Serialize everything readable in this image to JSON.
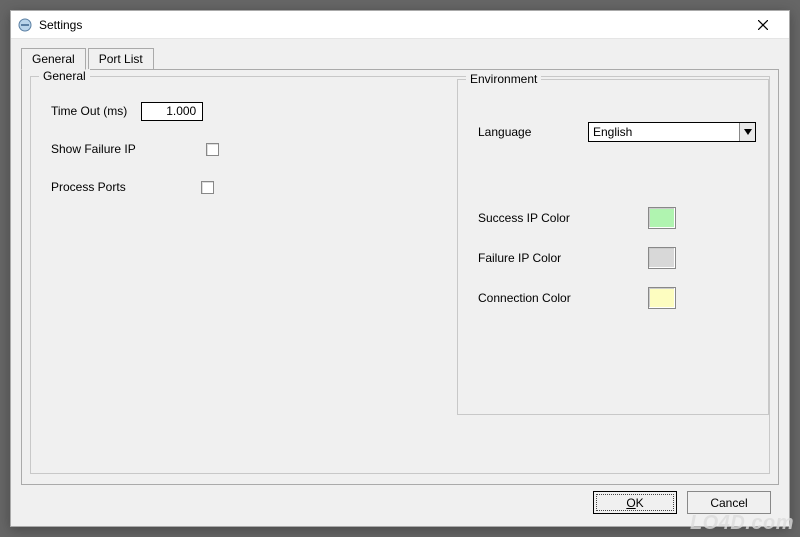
{
  "window": {
    "title": "Settings"
  },
  "tabs": [
    {
      "label": "General",
      "active": true
    },
    {
      "label": "Port List",
      "active": false
    }
  ],
  "general_group": {
    "legend": "General",
    "timeout_label": "Time Out (ms)",
    "timeout_value": "1.000",
    "show_failure_ip_label": "Show Failure IP",
    "show_failure_ip_checked": false,
    "process_ports_label": "Process Ports",
    "process_ports_checked": false
  },
  "environment_group": {
    "legend": "Environment",
    "language_label": "Language",
    "language_value": "English",
    "success_ip_color_label": "Success IP Color",
    "success_ip_color": "#b0f4b0",
    "failure_ip_color_label": "Failure IP Color",
    "failure_ip_color": "#d8d8d8",
    "connection_color_label": "Connection Color",
    "connection_color": "#fdfdc0"
  },
  "buttons": {
    "ok": "OK",
    "cancel": "Cancel"
  },
  "watermark": "LO4D.com"
}
